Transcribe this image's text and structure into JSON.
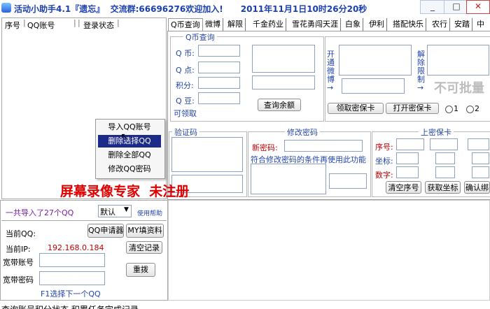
{
  "title": "活动小助手4.1『遗忘』  交流群:66696276欢迎加入!      2011年11月1日10时26分20秒",
  "window_buttons": {
    "minimize": "_",
    "maximize": "□",
    "close": "✕"
  },
  "list": {
    "headers": [
      "序号",
      "QQ账号",
      "",
      "登录状态"
    ]
  },
  "tabs": [
    "Q币查询",
    "微博",
    "解限",
    "千金药业",
    "雪花勇闯天涯",
    "白象",
    "伊利",
    "搭配快乐",
    "农行",
    "安踏",
    "中"
  ],
  "qb_query": {
    "group_title": "Q币查询",
    "labels": [
      "Q 币:",
      "Q 点:",
      "积分:",
      "Q 豆:"
    ],
    "claimable": "可领取",
    "query_button": "查询余额"
  },
  "mibao": {
    "open_label": "开通微博→",
    "remove_label": "解除限制→",
    "cannot_batch": "不可批量",
    "get_card_button": "领取密保卡",
    "open_card_button": "打开密保卡",
    "radio1": "1",
    "radio2": "2"
  },
  "captcha": {
    "group_title": "验证码"
  },
  "change_pw": {
    "group_title": "修改密码",
    "new_pw_label": "新密码:",
    "note": "符合修改密码的条件再使用此功能"
  },
  "card": {
    "group_title": "上密保卡",
    "labels": [
      "序号:",
      "坐标:",
      "数字:"
    ],
    "clear_button": "清空序号",
    "get_coord_button": "获取坐标",
    "confirm_button": "确认绑"
  },
  "context_menu": [
    "导入QQ账号",
    "删除选择QQ",
    "删除全部QQ",
    "修改QQ密码"
  ],
  "watermark": "屏幕录像专家  未注册",
  "bottom": {
    "imported_text": "一共导入了27个QQ",
    "select_value": "默认",
    "help_link": "使用帮助",
    "current_qq_label": "当前QQ:",
    "qq_apply_button": "QQ申请器",
    "my_fill_button": "MY填资料",
    "current_ip_label": "当前IP:",
    "ip_value": "192.168.0.184",
    "clear_log_button": "清空记录",
    "broadband_account_label": "宽带账号",
    "broadband_password_label": "宽带密码",
    "redial_button": "重拨",
    "f1_hint": "F1选择下一个QQ"
  },
  "status_bar": "查询账号积分状态,积累任务完成记录……"
}
